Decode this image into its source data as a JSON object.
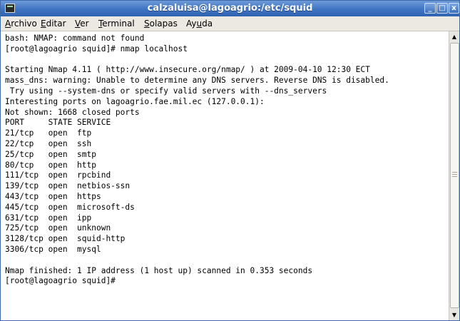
{
  "window": {
    "title": "calzaluisa@lagoagrio:/etc/squid",
    "buttons": {
      "minimize": "_",
      "maximize": "□",
      "close": "x"
    }
  },
  "menu": {
    "items": [
      {
        "mnemonic": "A",
        "rest": "rchivo"
      },
      {
        "mnemonic": "E",
        "rest": "ditar"
      },
      {
        "mnemonic": "V",
        "rest": "er"
      },
      {
        "mnemonic": "T",
        "rest": "erminal"
      },
      {
        "mnemonic": "S",
        "rest": "olapas"
      },
      {
        "pre": "Ay",
        "mnemonic": "u",
        "rest": "da"
      }
    ]
  },
  "terminal": {
    "lines": [
      "bash: NMAP: command not found",
      "[root@lagoagrio squid]# nmap localhost",
      "",
      "Starting Nmap 4.11 ( http://www.insecure.org/nmap/ ) at 2009-04-10 12:30 ECT",
      "mass_dns: warning: Unable to determine any DNS servers. Reverse DNS is disabled.",
      " Try using --system-dns or specify valid servers with --dns_servers",
      "Interesting ports on lagoagrio.fae.mil.ec (127.0.0.1):",
      "Not shown: 1668 closed ports",
      "PORT     STATE SERVICE",
      "21/tcp   open  ftp",
      "22/tcp   open  ssh",
      "25/tcp   open  smtp",
      "80/tcp   open  http",
      "111/tcp  open  rpcbind",
      "139/tcp  open  netbios-ssn",
      "443/tcp  open  https",
      "445/tcp  open  microsoft-ds",
      "631/tcp  open  ipp",
      "725/tcp  open  unknown",
      "3128/tcp open  squid-http",
      "3306/tcp open  mysql",
      "",
      "Nmap finished: 1 IP address (1 host up) scanned in 0.353 seconds",
      "[root@lagoagrio squid]#"
    ]
  },
  "scrollbar": {
    "up_arrow": "▲",
    "down_arrow": "▼"
  }
}
